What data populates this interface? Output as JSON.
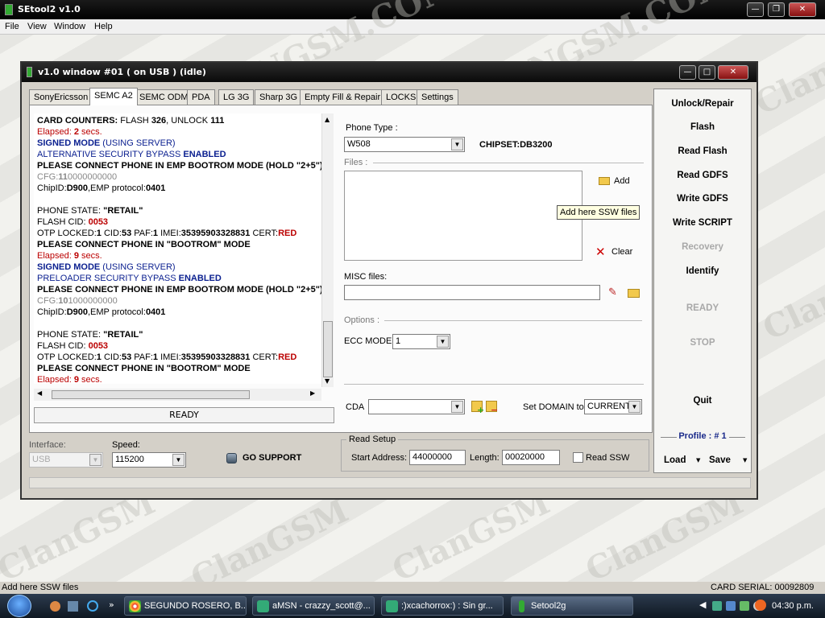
{
  "app": {
    "title": "SEtool2 v1.0"
  },
  "menu": [
    "File",
    "View",
    "Window",
    "Help"
  ],
  "watermark": {
    "text_a": "ClanGSM",
    "text_b": "CLANGSM.COM"
  },
  "window": {
    "title": "v1.0 window #01 ( on USB ) (idle)"
  },
  "tabs": [
    "SonyEricsson",
    "SEMC A2",
    "SEMC ODM",
    "PDA",
    "LG 3G",
    "Sharp 3G",
    "Empty Fill & Repair",
    "LOCKS",
    "Settings"
  ],
  "active_tab": "SEMC A2",
  "log": {
    "l01": [
      "CARD COUNTERS:",
      " FLASH ",
      "326",
      ", UNLOCK ",
      "111"
    ],
    "l02": [
      "Elapsed: ",
      "2",
      " secs."
    ],
    "l03": [
      "SIGNED MODE",
      " (USING SERVER)"
    ],
    "l04": [
      "ALTERNATIVE SECURITY BYPASS ",
      "ENABLED"
    ],
    "l05": "PLEASE CONNECT PHONE IN EMP BOOTROM MODE (HOLD \"2+5\")",
    "l06": [
      "CFG:",
      "11",
      "0000000000"
    ],
    "l07": [
      "ChipID:",
      "D900",
      ",EMP protocol:",
      "0401"
    ],
    "l09": [
      "PHONE STATE: ",
      "\"RETAIL\""
    ],
    "l10": [
      "FLASH CID: ",
      "0053"
    ],
    "l11": [
      "OTP LOCKED:",
      "1",
      " CID:",
      "53",
      " PAF:",
      "1",
      " IMEI:",
      "35395903328831",
      " CERT:",
      "RED"
    ],
    "l12": "PLEASE CONNECT PHONE IN \"BOOTROM\" MODE",
    "l13": [
      "Elapsed: ",
      "9",
      " secs."
    ],
    "l14": [
      "SIGNED MODE",
      " (USING SERVER)"
    ],
    "l15": [
      "PRELOADER SECURITY BYPASS ",
      "ENABLED"
    ],
    "l16": "PLEASE CONNECT PHONE IN EMP BOOTROM MODE (HOLD \"2+5\")",
    "l17": [
      "CFG:",
      "10",
      "1000000000"
    ],
    "l18": [
      "ChipID:",
      "D900",
      ",EMP protocol:",
      "0401"
    ],
    "l20": [
      "PHONE STATE: ",
      "\"RETAIL\""
    ],
    "l21": [
      "FLASH CID: ",
      "0053"
    ],
    "l22": [
      "OTP LOCKED:",
      "1",
      " CID:",
      "53",
      " PAF:",
      "1",
      " IMEI:",
      "35395903328831",
      " CERT:",
      "RED"
    ],
    "l23": "PLEASE CONNECT PHONE IN \"BOOTROM\" MODE",
    "l24": [
      "Elapsed: ",
      "9",
      " secs."
    ],
    "status": "READY"
  },
  "phone_type": {
    "label": "Phone Type :",
    "value": "W508",
    "chipset": "CHIPSET:DB3200"
  },
  "files": {
    "label": "Files :",
    "add": "Add",
    "clear": "Clear",
    "tooltip": "Add here SSW files"
  },
  "misc": {
    "label": "MISC files:"
  },
  "options": {
    "label": "Options :",
    "ecc_label": "ECC MODE",
    "ecc_value": "1"
  },
  "cda": {
    "label": "CDA",
    "value": "",
    "domain_label": "Set DOMAIN to",
    "domain_value": "CURRENT"
  },
  "right_panel": {
    "buttons": [
      "Unlock/Repair",
      "Flash",
      "Read Flash",
      "Read GDFS",
      "Write GDFS",
      "Write SCRIPT",
      "Recovery",
      "Identify",
      "READY",
      "STOP",
      "Quit"
    ],
    "profile": "Profile : # 1",
    "load": "Load",
    "save": "Save"
  },
  "interface": {
    "label": "Interface:",
    "value": "USB"
  },
  "speed": {
    "label": "Speed:",
    "value": "115200"
  },
  "go_support": "GO SUPPORT",
  "read_setup": {
    "label": "Read Setup",
    "start_label": "Start Address:",
    "start_value": "44000000",
    "length_label": "Length:",
    "length_value": "00020000",
    "read_ssw": "Read SSW"
  },
  "statusbar": {
    "left": "Add here SSW files",
    "right": "CARD SERIAL: 00092809"
  },
  "taskbar": {
    "items": [
      "SEGUNDO ROSERO, B...",
      "aMSN - crazzy_scott@...",
      ":)xcachorrox:) : Sin gr...",
      "Setool2g"
    ],
    "time": "04:30 p.m."
  },
  "colors": {
    "log_blue": "#0a1f8f",
    "log_red": "#b00000",
    "disabled": "#a8a8a8"
  }
}
